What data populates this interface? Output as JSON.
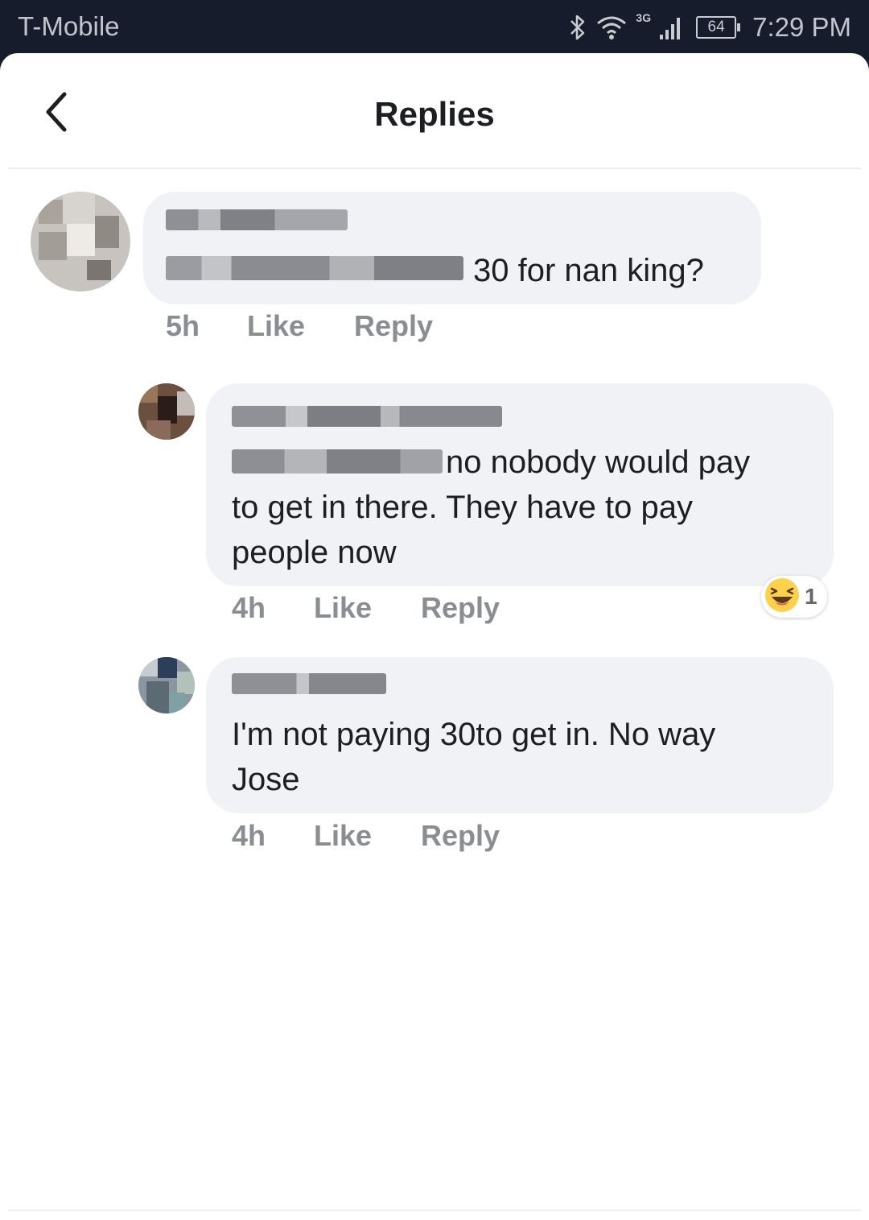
{
  "status_bar": {
    "carrier": "T-Mobile",
    "network_type": "3G",
    "battery": "64",
    "time": "7:29 PM",
    "icons": [
      "bluetooth-icon",
      "wifi-icon",
      "signal-icon",
      "battery-icon"
    ]
  },
  "header": {
    "title": "Replies",
    "back_icon": "chevron-left-icon"
  },
  "comments": [
    {
      "author": "",
      "text_visible": "30 for nan king?",
      "time": "5h",
      "like_label": "Like",
      "reply_label": "Reply"
    },
    {
      "author": "",
      "text_line1": "no nobody would pay",
      "text_line2": "to get in there. They have to pay",
      "text_line3": "people now",
      "time": "4h",
      "like_label": "Like",
      "reply_label": "Reply",
      "reaction": {
        "icon": "laughing-emoji-icon",
        "count": "1"
      }
    },
    {
      "author": "",
      "text_line1": "I'm not paying 30to get in. No way",
      "text_line2": "Jose",
      "time": "4h",
      "like_label": "Like",
      "reply_label": "Reply"
    }
  ],
  "colors": {
    "status_bar_bg": "#161c2c",
    "bubble_bg": "#f0f2f5",
    "action_text": "#8a8d91",
    "body_text": "#1c1e21"
  }
}
